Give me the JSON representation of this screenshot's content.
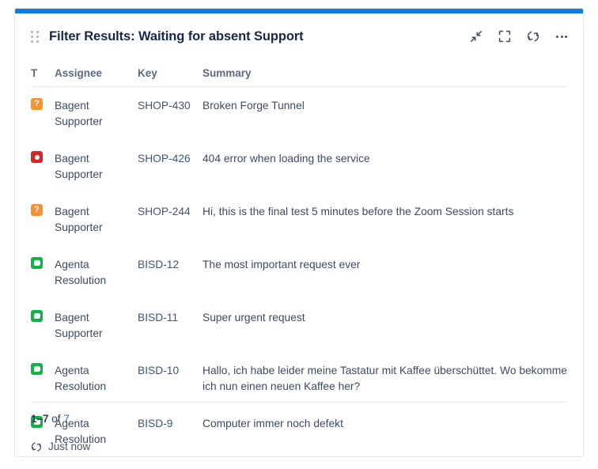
{
  "gadget": {
    "title": "Filter Results: Waiting for absent Support",
    "accent_color": "#0c7ce6",
    "drag_handle_name": "drag-handle"
  },
  "header_actions": [
    {
      "name": "collapse-icon",
      "label": "Minimise"
    },
    {
      "name": "fullscreen-icon",
      "label": "Maximise"
    },
    {
      "name": "refresh-icon",
      "label": "Refresh"
    },
    {
      "name": "more-options-icon",
      "label": "More actions"
    }
  ],
  "table": {
    "columns": [
      {
        "key": "type",
        "label": "T"
      },
      {
        "key": "assignee",
        "label": "Assignee"
      },
      {
        "key": "key",
        "label": "Key"
      },
      {
        "key": "summary",
        "label": "Summary"
      }
    ],
    "rows": [
      {
        "type_icon": "question",
        "type_glyph": "?",
        "type_color": "#f79232",
        "assignee": "Bagent Supporter",
        "key": "SHOP-430",
        "summary": "Broken Forge Tunnel"
      },
      {
        "type_icon": "bug",
        "type_glyph": "",
        "type_color": "#d7262b",
        "assignee": "Bagent Supporter",
        "key": "SHOP-426",
        "summary": "404 error when loading the service"
      },
      {
        "type_icon": "question",
        "type_glyph": "?",
        "type_color": "#f79232",
        "assignee": "Bagent Supporter",
        "key": "SHOP-244",
        "summary": "Hi, this is the final test 5 minutes before the Zoom Session starts"
      },
      {
        "type_icon": "service",
        "type_glyph": "",
        "type_color": "#14b14a",
        "assignee": "Agenta Resolution",
        "key": "BISD-12",
        "summary": "The most important request ever"
      },
      {
        "type_icon": "service",
        "type_glyph": "",
        "type_color": "#14b14a",
        "assignee": "Bagent Supporter",
        "key": "BISD-11",
        "summary": "Super urgent request"
      },
      {
        "type_icon": "service",
        "type_glyph": "",
        "type_color": "#14b14a",
        "assignee": "Agenta Resolution",
        "key": "BISD-10",
        "summary": "Hallo, ich habe leider meine Tastatur mit Kaffee überschüttet. Wo bekomme ich nun einen neuen Kaffee her?"
      },
      {
        "type_icon": "service",
        "type_glyph": "",
        "type_color": "#14b14a",
        "assignee": "Agenta Resolution",
        "key": "BISD-9",
        "summary": "Computer immer noch defekt"
      }
    ]
  },
  "pagination": {
    "range": "1–7",
    "of_label": "of",
    "total": "7"
  },
  "footer": {
    "refresh_status": "Just now"
  }
}
